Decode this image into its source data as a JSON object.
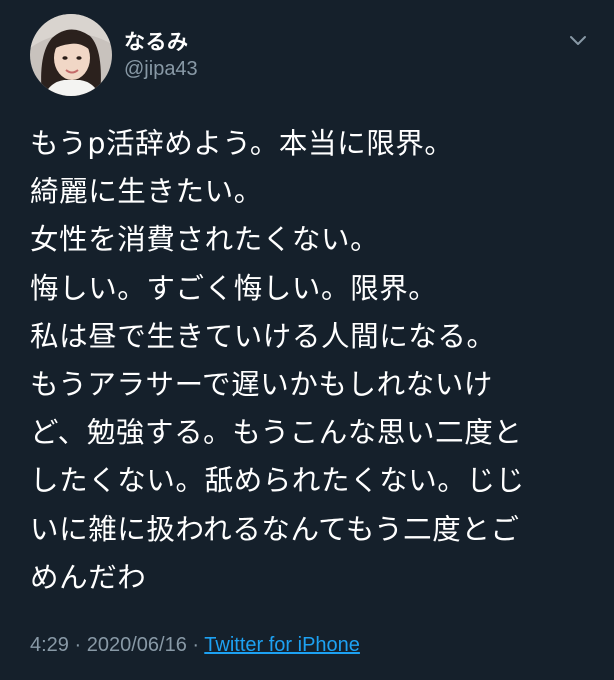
{
  "user": {
    "display_name": "なるみ",
    "handle": "@jipa43"
  },
  "tweet": {
    "lines": [
      "もうp活辞めよう。本当に限界。",
      "綺麗に生きたい。",
      "女性を消費されたくない。",
      "悔しい。すごく悔しい。限界。",
      "私は昼で生きていける人間になる。",
      "もうアラサーで遅いかもしれないけ",
      "ど、勉強する。もうこんな思い二度と",
      "したくない。舐められたくない。じじ",
      "いに雑に扱われるなんてもう二度とご",
      "めんだわ"
    ],
    "time": "4:29",
    "separator": "·",
    "date": "2020/06/16",
    "source": "Twitter for iPhone"
  },
  "icons": {
    "menu": "chevron-down-icon",
    "avatar": "profile-photo"
  },
  "colors": {
    "background": "#15202b",
    "text": "#ffffff",
    "muted": "#8899a6",
    "link": "#1da1f2"
  }
}
